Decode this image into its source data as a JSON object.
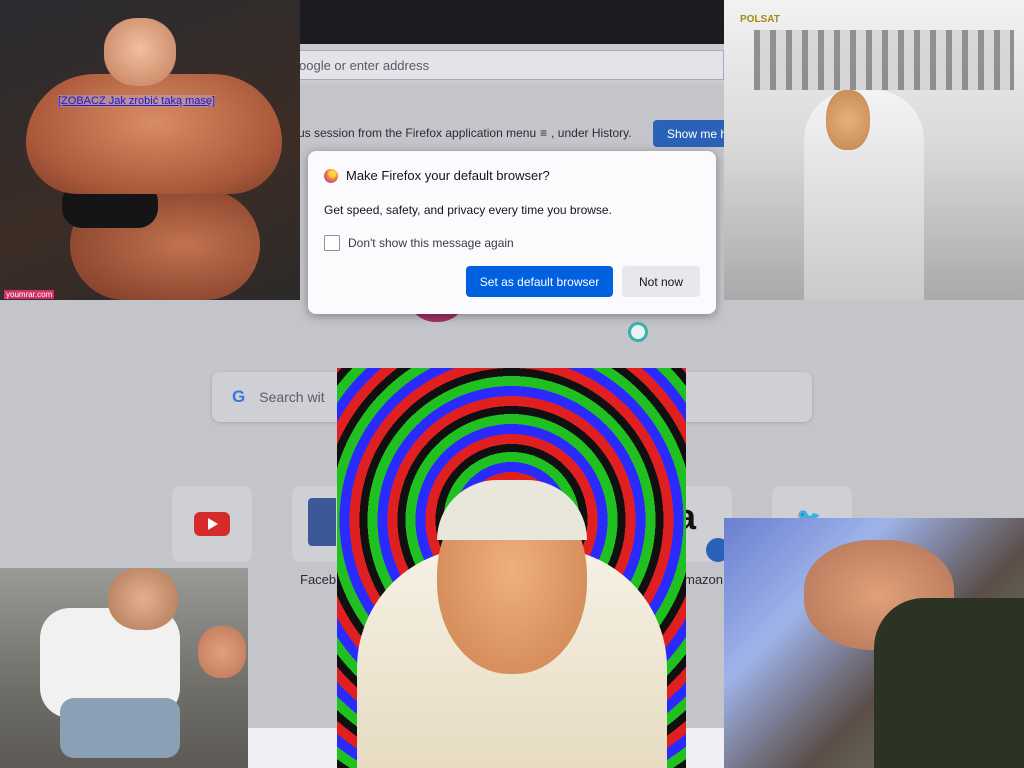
{
  "browser": {
    "url_placeholder": "oogle or enter address",
    "restore_message": "us session from the Firefox application menu",
    "menu_glyph": "≡",
    "restore_suffix": ", under History.",
    "show_me_button": "Show me ho"
  },
  "newtab": {
    "search_icon_glyph": "G",
    "search_placeholder": "Search wit",
    "tiles": [
      {
        "label": "Faceb",
        "icon": "facebook-icon"
      },
      {
        "label": "mazon",
        "icon": "amazon-icon"
      }
    ],
    "youtube_icon": "youtube-icon",
    "twitter_glyph": "🐦",
    "amazon_glyph": "a"
  },
  "modal": {
    "title": "Make Firefox your default browser?",
    "body": "Get speed, safety, and privacy every time you browse.",
    "checkbox_label": "Don't show this message again",
    "primary_button": "Set as default browser",
    "secondary_button": "Not now"
  },
  "overlays": {
    "bodybuilder_link": "[ZOBACZ Jak zrobić taką masę]",
    "bodybuilder_watermark": "youmrar.com",
    "kitchen_logo": "POLSAT"
  }
}
